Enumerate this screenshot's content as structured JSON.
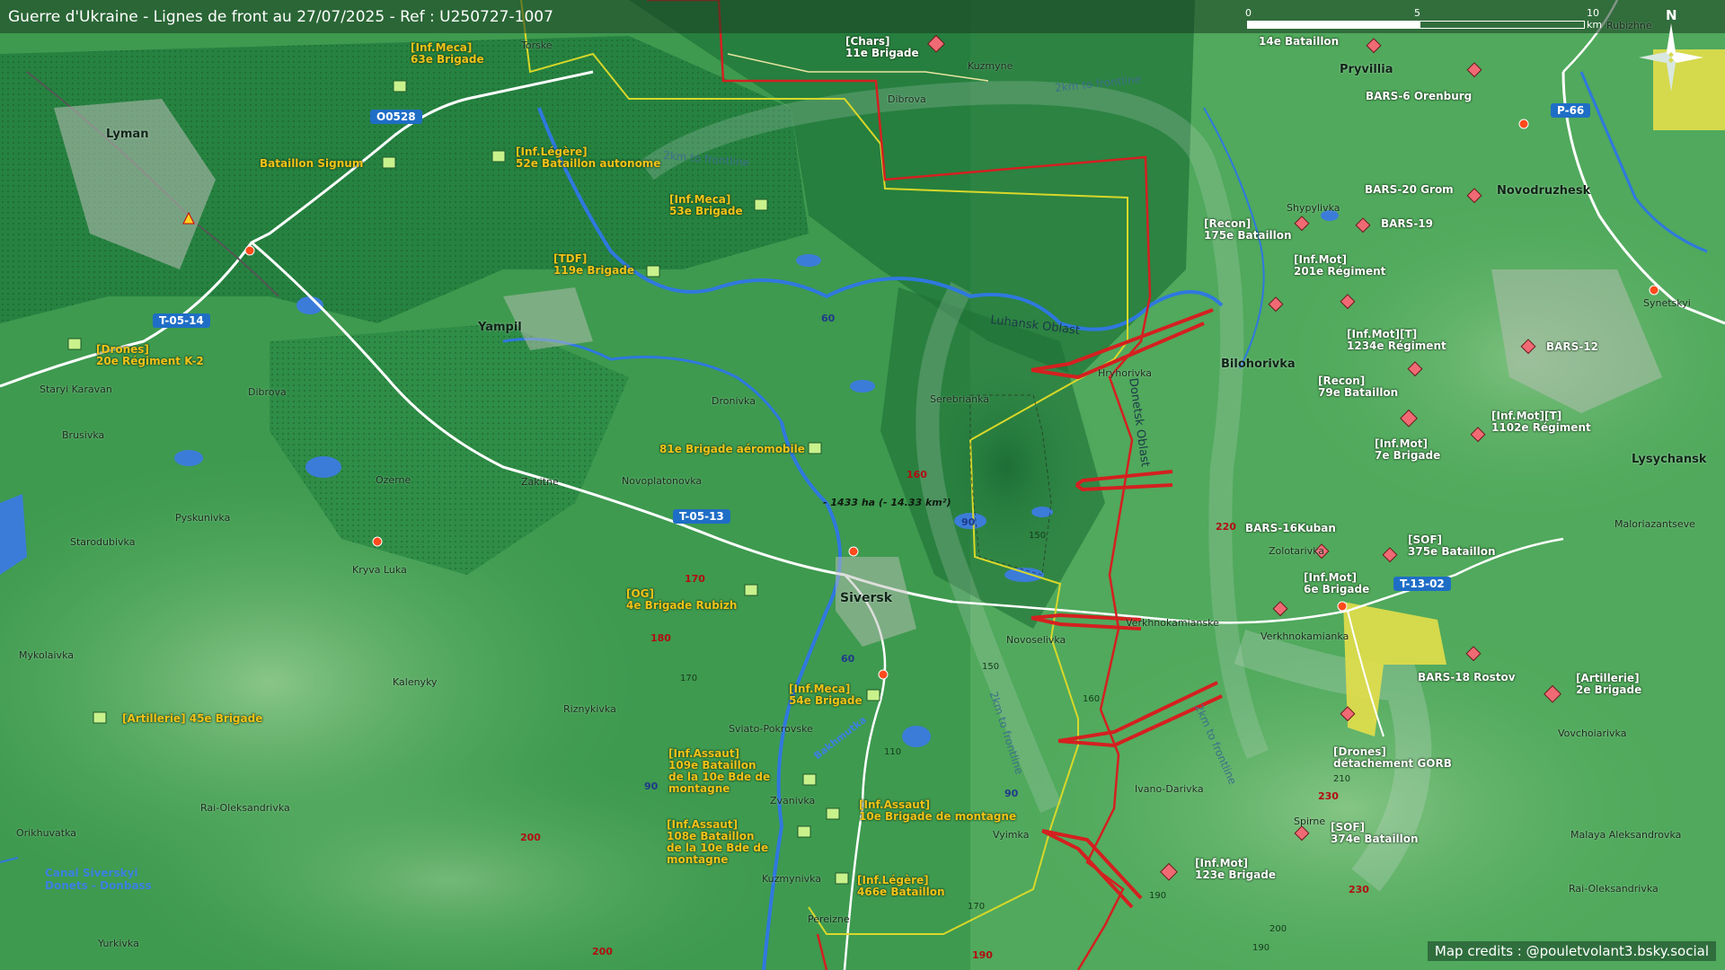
{
  "title": "Guerre d'Ukraine - Lignes de front au 27/07/2025 - Ref : U250727-1007",
  "scale": {
    "labels": [
      "0",
      "5",
      "10 km"
    ]
  },
  "north": {
    "label": "N"
  },
  "credits": "Map credits : @pouletvolant3.bsky.social",
  "area_note": "- 1433 ha (- 14.33 km²)",
  "oblasts": [
    "Luhansk Oblast",
    "Donetsk Oblast"
  ],
  "frontline_labels": [
    "2km to frontline",
    "2km to frontline",
    "2km to frontline",
    "2km to frontline"
  ],
  "water_labels": {
    "canal": "Canal Siverskyi\nDonets - Donbass",
    "river": "Bakhmutka"
  },
  "towns": [
    "Lyman",
    "Yampil",
    "Siversk",
    "Bilohorivka",
    "Lysychansk",
    "Pryvillia",
    "Novodruzhesk"
  ],
  "villages": [
    "Torske",
    "Kuzmyne",
    "Dibrova",
    "Staryi Karavan",
    "Dibrova",
    "Brusivka",
    "Ozerne",
    "Zakitne",
    "Novoplatonovka",
    "Dronivka",
    "Serebrianka",
    "Hryhorivka",
    "Starodubivka",
    "Pyskunivka",
    "Kryva Luka",
    "Mykolaivka",
    "Kalenyky",
    "Riznykivka",
    "Sviato-Pokrovske",
    "Novoselivka",
    "Verkhnokamianske",
    "Verkhnokamianka",
    "Zolotarivka",
    "Shypylivka",
    "Synetskyi",
    "Rubizhne",
    "Maloriazantseve",
    "Vovchoiarivka",
    "Rai-Oleksandrivka",
    "Orikhuvatka",
    "Yurkivka",
    "Zvanivka",
    "Kuzmynivka",
    "Pereizne",
    "Vyimka",
    "Ivano-Darivka",
    "Spirne",
    "Malaya Aleksandrovka",
    "Rai-Oleksandrivka"
  ],
  "roads": [
    "O0528",
    "T-05-14",
    "T-05-13",
    "P-66",
    "T-13-02"
  ],
  "altitudes": [
    "60",
    "160",
    "170",
    "180",
    "200",
    "200",
    "190",
    "220",
    "230",
    "230",
    "60",
    "90",
    "90",
    "90"
  ],
  "contours": [
    "150",
    "150",
    "160",
    "170",
    "110",
    "170",
    "190",
    "200",
    "190",
    "210"
  ],
  "ua_units": [
    "[Inf.Meca]\n63e Brigade",
    "Bataillon Signum",
    "[Inf.Légère]\n52e Bataillon autonome",
    "[Inf.Meca]\n53e Brigade",
    "[TDF]\n119e Brigade",
    "[Drones]\n20e Régiment K-2",
    "81e Brigade aéromobile",
    "[OG]\n4e Brigade Rubizh",
    "[Inf.Meca]\n54e Brigade",
    "[Artillerie] 45e Brigade",
    "[Inf.Assaut]\n109e Bataillon\nde la 10e Bde de\nmontagne",
    "[Inf.Assaut]\n10e Brigade de montagne",
    "[Inf.Assaut]\n108e Bataillon\nde la 10e Bde de\nmontagne",
    "[Inf.Légère]\n466e Bataillon"
  ],
  "ru_units": [
    "[Chars]\n11e Brigade",
    "14e Bataillon",
    "BARS-6 Orenburg",
    "BARS-20 Grom",
    "BARS-19",
    "[Recon]\n175e Bataillon",
    "[Inf.Mot]\n201e Régiment",
    "[Inf.Mot][T]\n1234e Régiment",
    "BARS-12",
    "[Recon]\n79e Bataillon",
    "[Inf.Mot]\n7e Brigade",
    "[Inf.Mot][T]\n1102e Régiment",
    "BARS-16Kuban",
    "[SOF]\n375e Bataillon",
    "[Inf.Mot]\n6e Brigade",
    "BARS-18 Rostov",
    "[Artillerie]\n2e Brigade",
    "[Drones]\ndétachement GORB",
    "[SOF]\n374e Bataillon",
    "[Inf.Mot]\n123e Brigade"
  ],
  "colors": {
    "ua_unit_text": "#f2c318",
    "ru_unit_text": "#ffffff",
    "frontline": "#d42020",
    "ua_symbol": "#c9f28c",
    "ru_symbol": "#f06a74",
    "road_shield": "#1f6ec6",
    "border_line": "#d8d82a"
  }
}
